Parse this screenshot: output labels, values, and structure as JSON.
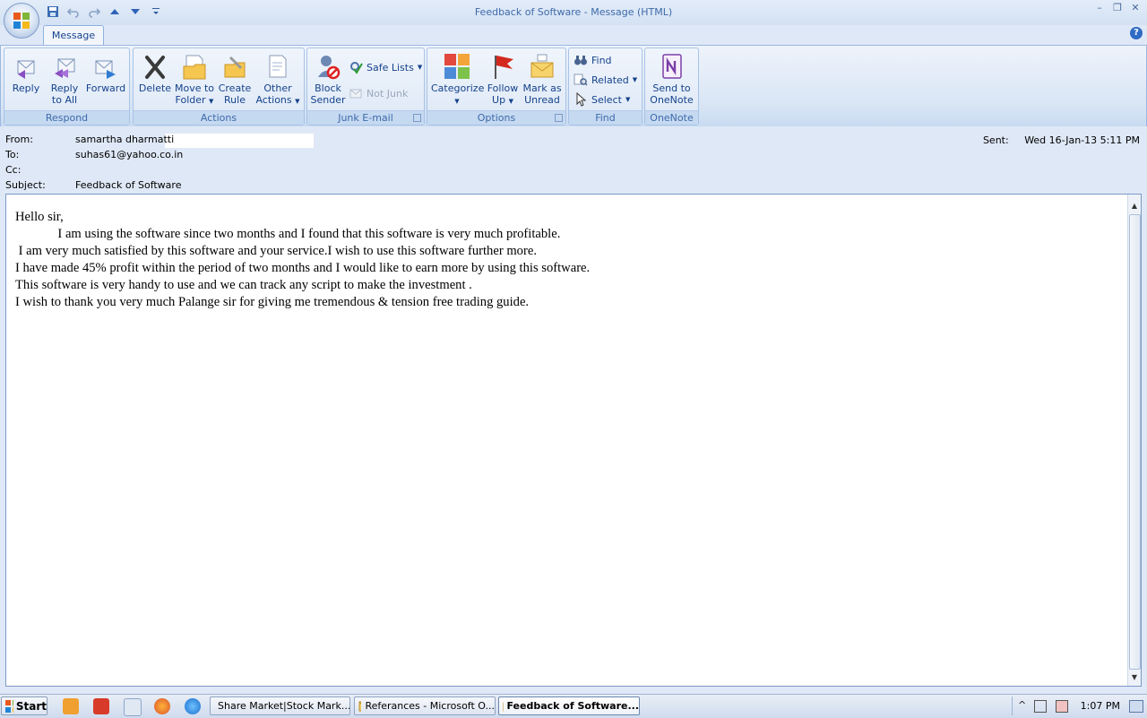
{
  "window": {
    "title": "Feedback of Software - Message (HTML)"
  },
  "ribbon": {
    "tab": "Message",
    "groups": {
      "respond": {
        "label": "Respond",
        "reply": [
          "Reply",
          ""
        ],
        "reply_all": [
          "Reply",
          "to All"
        ],
        "forward": [
          "Forward",
          ""
        ]
      },
      "actions": {
        "label": "Actions",
        "delete": [
          "Delete",
          ""
        ],
        "move": [
          "Move to",
          "Folder"
        ],
        "create_rule": [
          "Create",
          "Rule"
        ],
        "other": [
          "Other",
          "Actions"
        ]
      },
      "junk": {
        "label": "Junk E-mail",
        "block": [
          "Block",
          "Sender"
        ],
        "safe_lists": "Safe Lists",
        "not_junk": "Not Junk"
      },
      "options": {
        "label": "Options",
        "categorize": "Categorize",
        "follow_up": [
          "Follow",
          "Up"
        ],
        "mark_unread": [
          "Mark as",
          "Unread"
        ]
      },
      "find": {
        "label": "Find",
        "find": "Find",
        "related": "Related",
        "select": "Select"
      },
      "onenote": {
        "label": "OneNote",
        "send": [
          "Send to",
          "OneNote"
        ]
      }
    }
  },
  "header": {
    "from_label": "From:",
    "from_value": "samartha dharmatti",
    "to_label": "To:",
    "to_value": "suhas61@yahoo.co.in",
    "cc_label": "Cc:",
    "cc_value": "",
    "subject_label": "Subject:",
    "subject_value": "Feedback of Software",
    "sent_label": "Sent:",
    "sent_value": "Wed 16-Jan-13 5:11 PM"
  },
  "body": {
    "lines": [
      "Hello sir,",
      "             I am using the software since two months and I found that this software is very much profitable.",
      " I am very much satisfied by this software and your service.I wish to use this software further more.",
      "I have made 45% profit within the period of two months and I would like to earn more by using this software.",
      "This software is very handy to use and we can track any script to make the investment .",
      "I wish to thank you very much Palange sir for giving me tremendous & tension free trading guide."
    ]
  },
  "taskbar": {
    "start": "Start",
    "tasks": [
      "Share Market|Stock Mark...",
      "Referances - Microsoft O...",
      "Feedback of Software..."
    ],
    "clock": "1:07 PM"
  }
}
